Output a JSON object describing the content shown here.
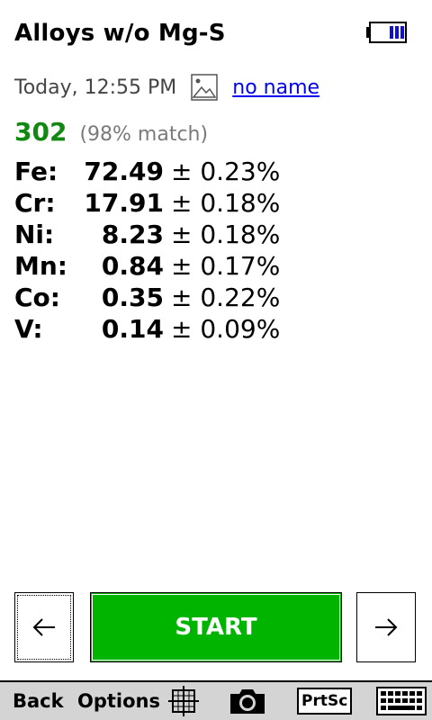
{
  "header": {
    "title": "Alloys w/o Mg-S",
    "battery_icon": "battery-icon"
  },
  "meta": {
    "date": "Today, 12:55 PM",
    "photo_icon": "image-icon",
    "name_link": "no name"
  },
  "result": {
    "grade": "302",
    "match": "(98% match)"
  },
  "elements": [
    {
      "symbol": "Fe:",
      "value": "72.49",
      "error": "± 0.23%"
    },
    {
      "symbol": "Cr:",
      "value": "17.91",
      "error": "± 0.18%"
    },
    {
      "symbol": "Ni:",
      "value": "8.23",
      "error": "± 0.18%"
    },
    {
      "symbol": "Mn:",
      "value": "0.84",
      "error": "± 0.17%"
    },
    {
      "symbol": "Co:",
      "value": "0.35",
      "error": "± 0.22%"
    },
    {
      "symbol": "V:",
      "value": "0.14",
      "error": "± 0.09%"
    }
  ],
  "controls": {
    "prev_icon": "arrow-left-icon",
    "start_label": "START",
    "next_icon": "arrow-right-icon"
  },
  "toolbar": {
    "back_label": "Back",
    "options_label": "Options",
    "crosshair_icon": "crosshair-icon",
    "camera_icon": "camera-icon",
    "prtsc_label": "PrtSc",
    "keyboard_icon": "keyboard-icon"
  },
  "colors": {
    "start_green": "#00b400",
    "grade_green": "#118811",
    "link_blue": "#0000ee",
    "toolbar_gray": "#d4d4d4"
  }
}
